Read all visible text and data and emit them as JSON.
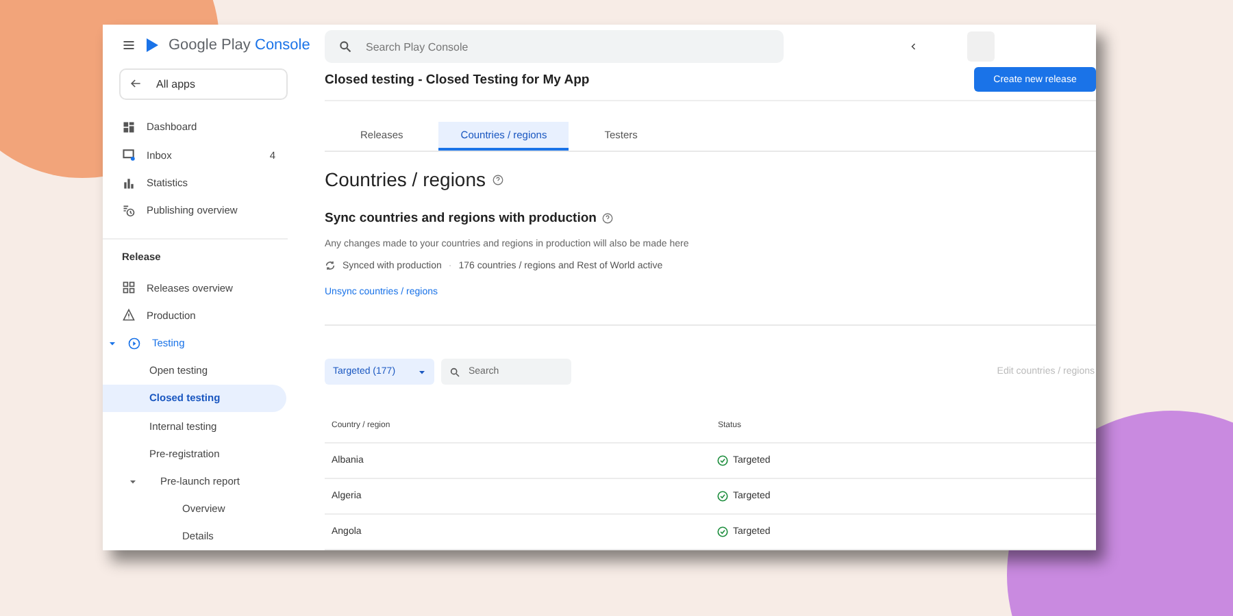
{
  "sidebar": {
    "brand": {
      "name": "Google Play",
      "product": "Console"
    },
    "back_link": "All apps",
    "items": [
      {
        "label": "Dashboard",
        "selected": false
      },
      {
        "label": "Inbox",
        "badge": "4",
        "selected": false
      },
      {
        "label": "Statistics",
        "selected": false
      },
      {
        "label": "Publishing overview",
        "selected": false
      }
    ],
    "release": {
      "heading": "Release",
      "items": [
        {
          "label": "Releases overview",
          "selected": false
        },
        {
          "label": "Production",
          "selected": false
        },
        {
          "label": "Testing",
          "selected": false,
          "expanded": true,
          "children": [
            {
              "label": "Open testing",
              "selected": false
            },
            {
              "label": "Closed testing",
              "selected": true
            },
            {
              "label": "Internal testing",
              "selected": false
            },
            {
              "label": "Pre-registration",
              "selected": false
            },
            {
              "label": "Pre-launch report",
              "selected": false,
              "expanded": true,
              "children": [
                {
                  "label": "Overview",
                  "selected": false
                },
                {
                  "label": "Details",
                  "selected": false
                }
              ]
            }
          ]
        }
      ]
    }
  },
  "topbar": {
    "search": {
      "placeholder": "Search Play Console"
    }
  },
  "page": {
    "title": "Closed testing - Closed Testing for My App",
    "primary_button": "Create new release",
    "tabs": [
      {
        "label": "Releases",
        "selected": false
      },
      {
        "label": "Countries / regions",
        "selected": true
      },
      {
        "label": "Testers",
        "selected": false
      }
    ],
    "heading": "Countries / regions",
    "sync": {
      "heading": "Sync countries and regions with production",
      "description": "Any changes made to your countries and regions in production will also be made here",
      "status": "Synced with production",
      "separator": "·",
      "summary": "176 countries / regions and Rest of World active",
      "link": "Unsync countries / regions"
    },
    "filter": {
      "value": "Targeted (177)",
      "search_placeholder": "Search",
      "edit_link": "Edit countries / regions"
    },
    "table": {
      "columns": [
        "Country / region",
        "Status"
      ],
      "rows": [
        {
          "country": "Albania",
          "status": "Targeted"
        },
        {
          "country": "Algeria",
          "status": "Targeted"
        },
        {
          "country": "Angola",
          "status": "Targeted"
        }
      ]
    }
  }
}
